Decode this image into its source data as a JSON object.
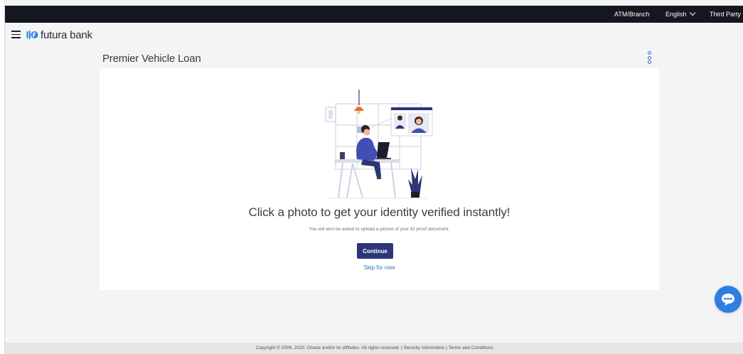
{
  "topbar": {
    "atm_branch": "ATM/Branch",
    "language": "English",
    "third_party": "Third Party"
  },
  "header": {
    "brand": "futura bank"
  },
  "page": {
    "title": "Premier Vehicle Loan"
  },
  "content": {
    "headline": "Click a photo to get your identity verified instantly!",
    "subtext": "You will also be asked to upload a picture of your ID proof document.",
    "continue_label": "Continue",
    "skip_label": "Skip for now"
  },
  "footer": {
    "copyright": "Copyright © 2006, 2020, Oracle and/or its affiliates. All rights reserved.",
    "separator": "|",
    "security": "Security Information",
    "terms": "Terms and Conditions"
  },
  "colors": {
    "topbar_bg": "#14171f",
    "primary_button": "#2c3578",
    "link": "#2f6fc8",
    "chat_fab": "#2e7de1"
  },
  "icons": [
    "hamburger-menu-icon",
    "futura-bank-logo-icon",
    "chevron-down-icon",
    "kebab-menu-icon",
    "chat-bubble-icon"
  ]
}
